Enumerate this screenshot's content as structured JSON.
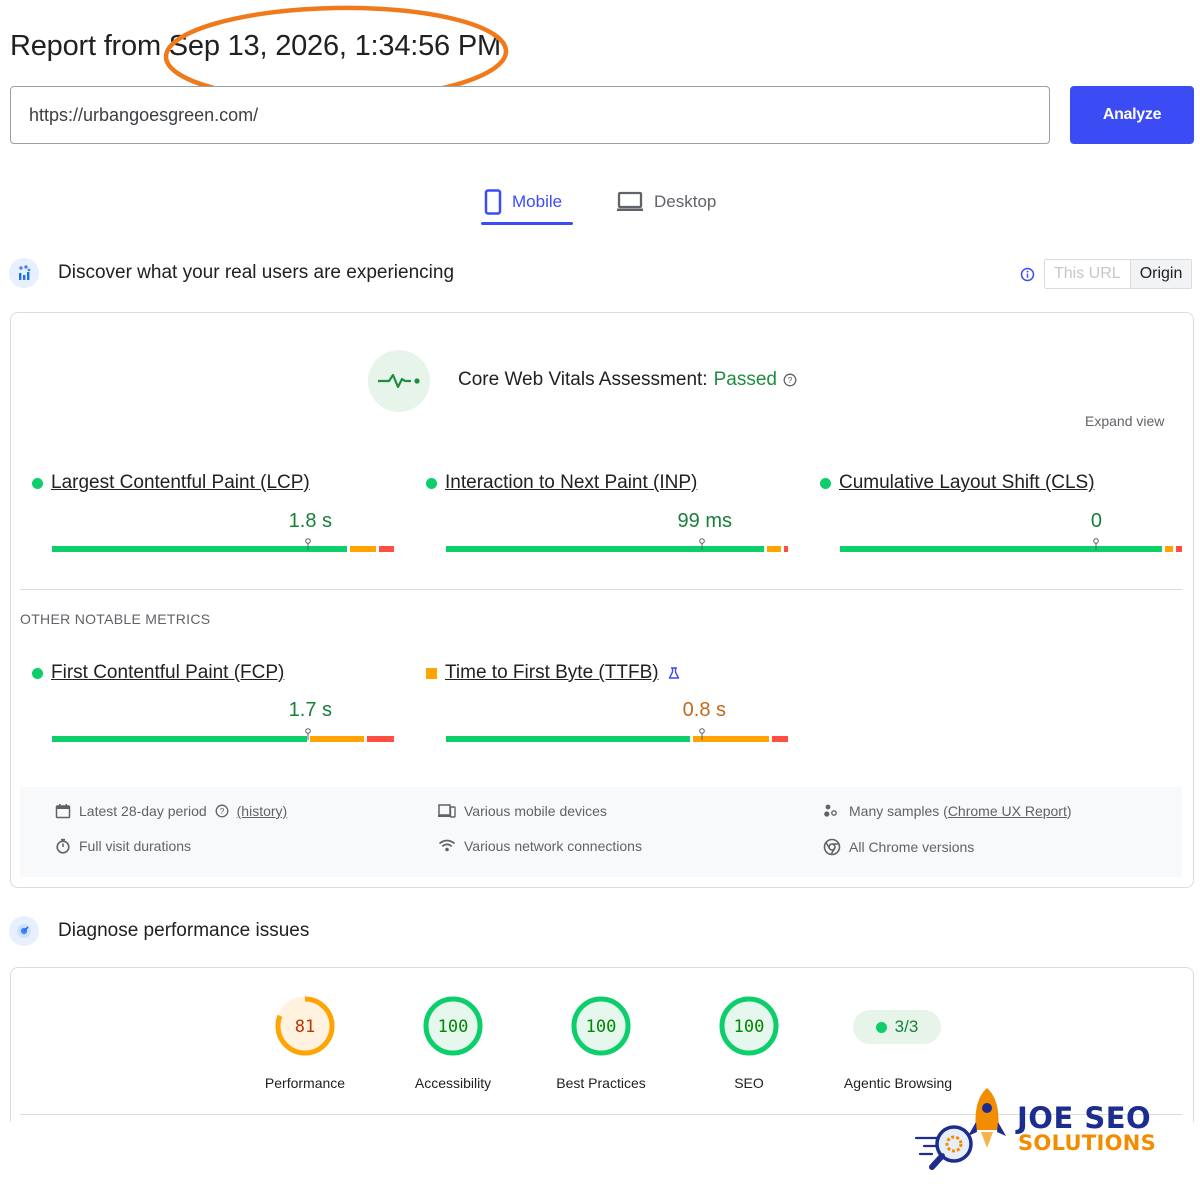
{
  "header": {
    "report_prefix": "Report from ",
    "report_date": "Sep 13, 2026, 1:34:56 PM",
    "highlight_color": "#f07a1a"
  },
  "url_bar": {
    "value": "https://urbangoesgreen.com/",
    "analyze_label": "Analyze"
  },
  "tabs": {
    "mobile": "Mobile",
    "desktop": "Desktop",
    "active": "Mobile"
  },
  "crux": {
    "title": "Discover what your real users are experiencing",
    "toggle": {
      "this_url": "This URL",
      "origin": "Origin",
      "selected": "Origin"
    },
    "assessment_label": "Core Web Vitals Assessment: ",
    "assessment_status": "Passed",
    "expand_view": "Expand view",
    "core_metrics": [
      {
        "name": "Largest Contentful Paint (LCP)",
        "value": "1.8 s",
        "rating": "good"
      },
      {
        "name": "Interaction to Next Paint (INP)",
        "value": "99 ms",
        "rating": "good"
      },
      {
        "name": "Cumulative Layout Shift (CLS)",
        "value": "0",
        "rating": "good"
      }
    ],
    "other_title": "OTHER NOTABLE METRICS",
    "other_metrics": [
      {
        "name": "First Contentful Paint (FCP)",
        "value": "1.7 s",
        "rating": "good"
      },
      {
        "name": "Time to First Byte (TTFB)",
        "value": "0.8 s",
        "rating": "needs-improvement"
      }
    ],
    "footer": {
      "period": "Latest 28-day period",
      "history": "(history)",
      "devices": "Various mobile devices",
      "samples_prefix": "Many samples (",
      "samples_link": "Chrome UX Report",
      "samples_suffix": ")",
      "durations": "Full visit durations",
      "network": "Various network connections",
      "chrome": "All Chrome versions"
    }
  },
  "diagnose": {
    "title": "Diagnose performance issues",
    "scores": [
      {
        "label": "Performance",
        "score": "81",
        "color": "#ffa400",
        "text_color": "#c33300",
        "fill": "#fff3e0",
        "fraction": 0.81
      },
      {
        "label": "Accessibility",
        "score": "100",
        "color": "#0cce6b",
        "text_color": "#008800",
        "fill": "#e6f7ee",
        "fraction": 1.0
      },
      {
        "label": "Best Practices",
        "score": "100",
        "color": "#0cce6b",
        "text_color": "#008800",
        "fill": "#e6f7ee",
        "fraction": 1.0
      },
      {
        "label": "SEO",
        "score": "100",
        "color": "#0cce6b",
        "text_color": "#008800",
        "fill": "#e6f7ee",
        "fraction": 1.0
      }
    ],
    "agentic": {
      "label": "Agentic Browsing",
      "value": "3/3"
    }
  },
  "logo": {
    "line1": "JOE SEO",
    "line2": "SOLUTIONS"
  },
  "colors": {
    "accent": "#3c4cf5",
    "good": "#0cce6b",
    "average": "#ffa400",
    "poor": "#ff4e42"
  }
}
